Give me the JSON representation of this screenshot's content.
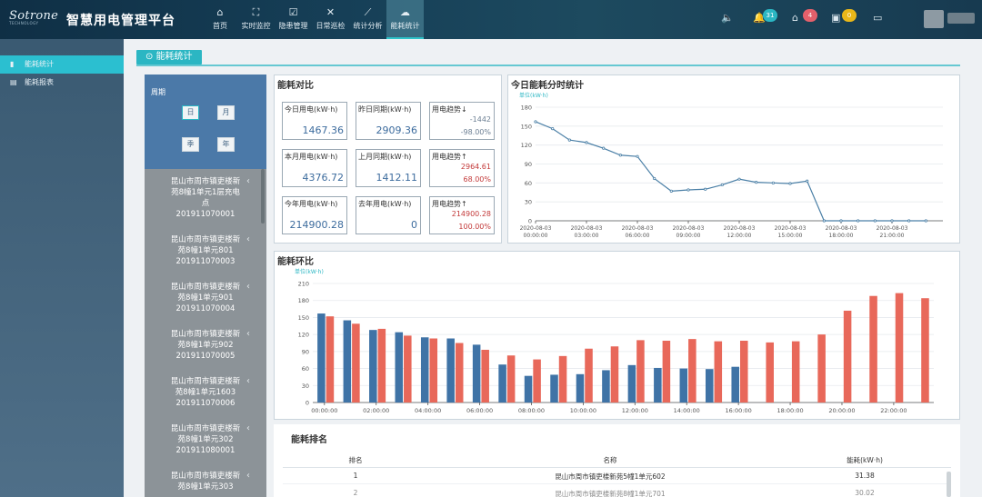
{
  "header": {
    "brand": "Sotrone",
    "brand_sub": "TECHNOLOGY",
    "title": "智慧用电管理平台",
    "nav": [
      {
        "label": "首页",
        "icon": "home-icon",
        "glyph": "⌂"
      },
      {
        "label": "实时监控",
        "icon": "monitor-icon",
        "glyph": "⛶"
      },
      {
        "label": "隐患管理",
        "icon": "checklist-icon",
        "glyph": "☑"
      },
      {
        "label": "日常巡检",
        "icon": "tools-icon",
        "glyph": "✕"
      },
      {
        "label": "统计分析",
        "icon": "analysis-icon",
        "glyph": "⟋"
      },
      {
        "label": "能耗统计",
        "icon": "energy-icon",
        "glyph": "☁"
      }
    ],
    "badges": {
      "bell": "31",
      "home": "4",
      "device": "0"
    },
    "accent": "#2bb6c3"
  },
  "sidebar": {
    "items": [
      {
        "label": "能耗统计",
        "icon": "bar-chart-icon"
      },
      {
        "label": "能耗报表",
        "icon": "table-icon"
      }
    ]
  },
  "page": {
    "tab": "能耗统计"
  },
  "filter": {
    "period_title": "周期",
    "periods": [
      "日",
      "月",
      "季",
      "年"
    ],
    "devices": [
      {
        "line1": "昆山市周市镇吏楼新",
        "line2": "苑8幢1单元1层充电",
        "line3": "点",
        "code": "201911070001"
      },
      {
        "line1": "昆山市周市镇吏楼新",
        "line2": "苑8幢1单元801",
        "line3": "",
        "code": "201911070003"
      },
      {
        "line1": "昆山市周市镇吏楼新",
        "line2": "苑8幢1单元901",
        "line3": "",
        "code": "201911070004"
      },
      {
        "line1": "昆山市周市镇吏楼新",
        "line2": "苑8幢1单元902",
        "line3": "",
        "code": "201911070005"
      },
      {
        "line1": "昆山市周市镇吏楼新",
        "line2": "苑8幢1单元1603",
        "line3": "",
        "code": "201911070006"
      },
      {
        "line1": "昆山市周市镇吏楼新",
        "line2": "苑8幢1单元302",
        "line3": "",
        "code": "201911080001"
      },
      {
        "line1": "昆山市周市镇吏楼新",
        "line2": "苑8幢1单元303",
        "line3": "",
        "code": ""
      }
    ]
  },
  "compare": {
    "title": "能耗对比",
    "metrics": [
      {
        "label": "今日用电(kW·h)",
        "value": "1467.36"
      },
      {
        "label": "昨日同期(kW·h)",
        "value": "2909.36"
      },
      {
        "label": "用电趋势↓",
        "diff": "-1442",
        "pct": "-98.00%",
        "trend": "down"
      },
      {
        "label": "本月用电(kW·h)",
        "value": "4376.72"
      },
      {
        "label": "上月同期(kW·h)",
        "value": "1412.11"
      },
      {
        "label": "用电趋势↑",
        "diff": "2964.61",
        "pct": "68.00%",
        "trend": "up"
      },
      {
        "label": "今年用电(kW·h)",
        "value": "214900.28"
      },
      {
        "label": "去年用电(kW·h)",
        "value": "0"
      },
      {
        "label": "用电趋势↑",
        "diff": "214900.28",
        "pct": "100.00%",
        "trend": "up"
      }
    ]
  },
  "chart_data": [
    {
      "type": "line",
      "title": "今日能耗分时统计",
      "ylabel": "单位(kW·h)",
      "ylim": [
        0,
        180
      ],
      "yticks": [
        0,
        30,
        60,
        90,
        120,
        150,
        180
      ],
      "xticks": [
        {
          "date": "2020-08-03",
          "time": "00:00:00"
        },
        {
          "date": "2020-08-03",
          "time": "03:00:00"
        },
        {
          "date": "2020-08-03",
          "time": "06:00:00"
        },
        {
          "date": "2020-08-03",
          "time": "09:00:00"
        },
        {
          "date": "2020-08-03",
          "time": "12:00:00"
        },
        {
          "date": "2020-08-03",
          "time": "15:00:00"
        },
        {
          "date": "2020-08-03",
          "time": "18:00:00"
        },
        {
          "date": "2020-08-03",
          "time": "21:00:00"
        }
      ],
      "x_hours": [
        0,
        1,
        2,
        3,
        4,
        5,
        6,
        7,
        8,
        9,
        10,
        11,
        12,
        13,
        14,
        15,
        16,
        17,
        18,
        19,
        20,
        21,
        22,
        23
      ],
      "values": [
        157,
        146,
        128,
        124,
        115,
        104,
        102,
        67,
        47,
        49,
        50,
        57,
        66,
        61,
        60,
        59,
        63,
        0,
        0,
        0,
        0,
        0,
        0,
        0
      ],
      "color": "#4a7fa6"
    },
    {
      "type": "bar",
      "title": "能耗环比",
      "ylabel": "单位(kW·h)",
      "ylim": [
        0,
        210
      ],
      "yticks": [
        0,
        30,
        60,
        90,
        120,
        150,
        180,
        210
      ],
      "xticks": [
        "00:00:00",
        "02:00:00",
        "04:00:00",
        "06:00:00",
        "08:00:00",
        "10:00:00",
        "12:00:00",
        "14:00:00",
        "16:00:00",
        "18:00:00",
        "20:00:00",
        "22:00:00"
      ],
      "categories": [
        "0",
        "1",
        "2",
        "3",
        "4",
        "5",
        "6",
        "7",
        "8",
        "9",
        "10",
        "11",
        "12",
        "13",
        "14",
        "15",
        "16",
        "17",
        "18",
        "19",
        "20",
        "21",
        "22",
        "23"
      ],
      "series": [
        {
          "color": "#3f73a6",
          "values": [
            157,
            145,
            128,
            124,
            115,
            113,
            102,
            67,
            47,
            49,
            50,
            57,
            66,
            61,
            60,
            59,
            63,
            null,
            null,
            null,
            null,
            null,
            null,
            null
          ]
        },
        {
          "color": "#e8685a",
          "values": [
            152,
            139,
            130,
            118,
            113,
            105,
            93,
            83,
            76,
            82,
            95,
            99,
            110,
            109,
            112,
            108,
            109,
            106,
            108,
            120,
            162,
            188,
            193,
            184
          ]
        }
      ]
    }
  ],
  "ranking": {
    "title": "能耗排名",
    "headers": {
      "rank": "排名",
      "name": "名称",
      "energy": "能耗(kW·h)"
    },
    "rows": [
      {
        "rank": "1",
        "name": "昆山市周市镇吏楼新苑5幢1单元602",
        "energy": "31.38"
      },
      {
        "rank": "2",
        "name": "昆山市周市镇吏楼新苑8幢1单元701",
        "energy": "30.02"
      }
    ]
  }
}
